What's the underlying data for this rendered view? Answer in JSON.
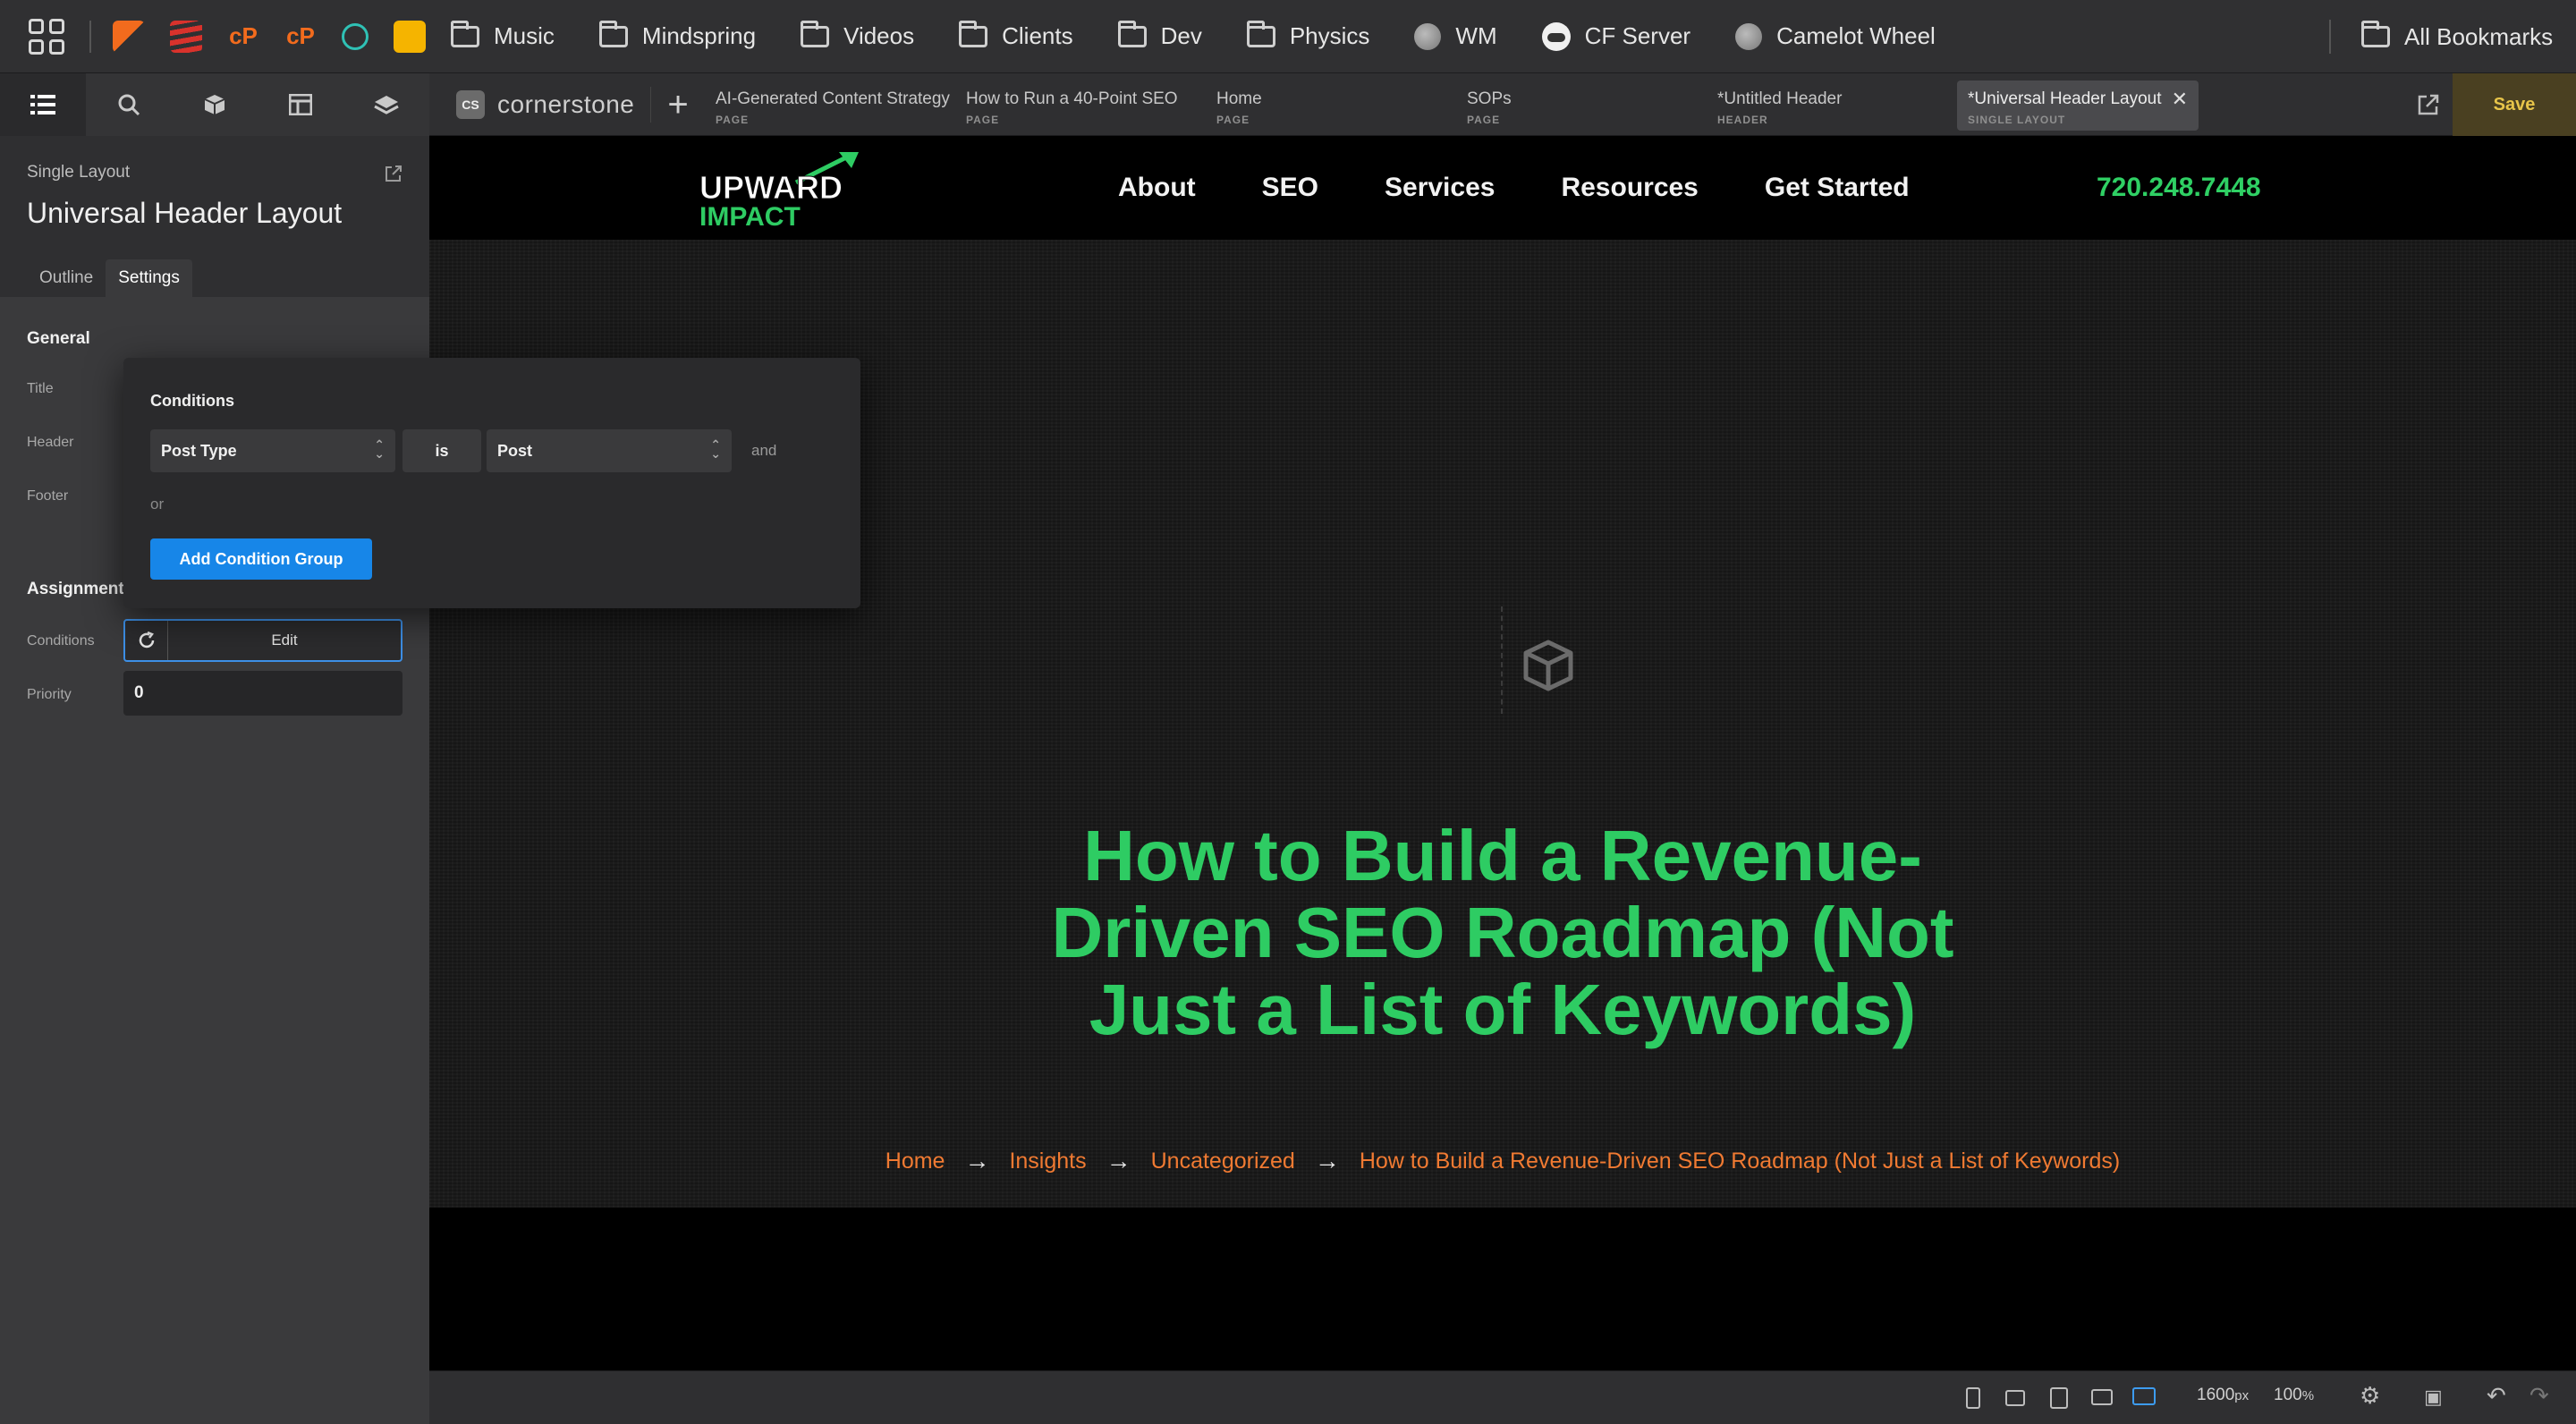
{
  "bookmarks": {
    "items": [
      {
        "label": "Music",
        "icon": "folder-icon"
      },
      {
        "label": "Mindspring",
        "icon": "folder-icon"
      },
      {
        "label": "Videos",
        "icon": "folder-icon"
      },
      {
        "label": "Clients",
        "icon": "folder-icon"
      },
      {
        "label": "Dev",
        "icon": "folder-icon"
      },
      {
        "label": "Physics",
        "icon": "folder-icon"
      },
      {
        "label": "WM",
        "icon": "globe-icon"
      },
      {
        "label": "CF Server",
        "icon": "cloud-icon"
      },
      {
        "label": "Camelot Wheel",
        "icon": "globe-icon"
      }
    ],
    "all_label": "All Bookmarks",
    "fav_glyphs": [
      "cP",
      "cP"
    ]
  },
  "app": {
    "logo_badge": "CS",
    "logo_word": "cornerstone",
    "tabs": [
      {
        "title": "AI-Generated Content Strategy",
        "type": "PAGE"
      },
      {
        "title": "How to Run a 40-Point SEO",
        "type": "PAGE"
      },
      {
        "title": "Home",
        "type": "PAGE"
      },
      {
        "title": "SOPs",
        "type": "PAGE"
      },
      {
        "title": "*Untitled Header",
        "type": "HEADER"
      }
    ],
    "active_tab": {
      "title": "*Universal Header Layout",
      "type": "SINGLE LAYOUT"
    },
    "save_label": "Save"
  },
  "panel": {
    "kind": "Single Layout",
    "title": "Universal Header Layout",
    "tabs": {
      "outline": "Outline",
      "settings": "Settings"
    },
    "general_title": "General",
    "labels": {
      "title": "Title",
      "header": "Header",
      "footer": "Footer"
    },
    "assignment_title": "Assignment",
    "conditions_label": "Conditions",
    "conditions_edit": "Edit",
    "priority_label": "Priority",
    "priority_value": "0"
  },
  "popup": {
    "title": "Conditions",
    "field": "Post Type",
    "operator": "is",
    "value": "Post",
    "and_label": "and",
    "or_label": "or",
    "add_group_label": "Add Condition Group"
  },
  "site": {
    "logo_top": "UPWARD",
    "logo_bottom": "IMPACT",
    "nav": [
      "About",
      "SEO",
      "Services",
      "Resources",
      "Get Started"
    ],
    "phone": "720.248.7448",
    "hero_title": "How to Build a Revenue-Driven SEO Roadmap (Not Just a List of Keywords)",
    "breadcrumbs": [
      "Home",
      "Insights",
      "Uncategorized",
      "How to Build a Revenue-Driven SEO Roadmap (Not Just a List of Keywords)"
    ],
    "colors": {
      "accent": "#2ecc63",
      "breadcrumb": "#f07a32"
    }
  },
  "status": {
    "width_value": "1600",
    "width_unit": "px",
    "zoom_value": "100",
    "zoom_unit": "%"
  }
}
